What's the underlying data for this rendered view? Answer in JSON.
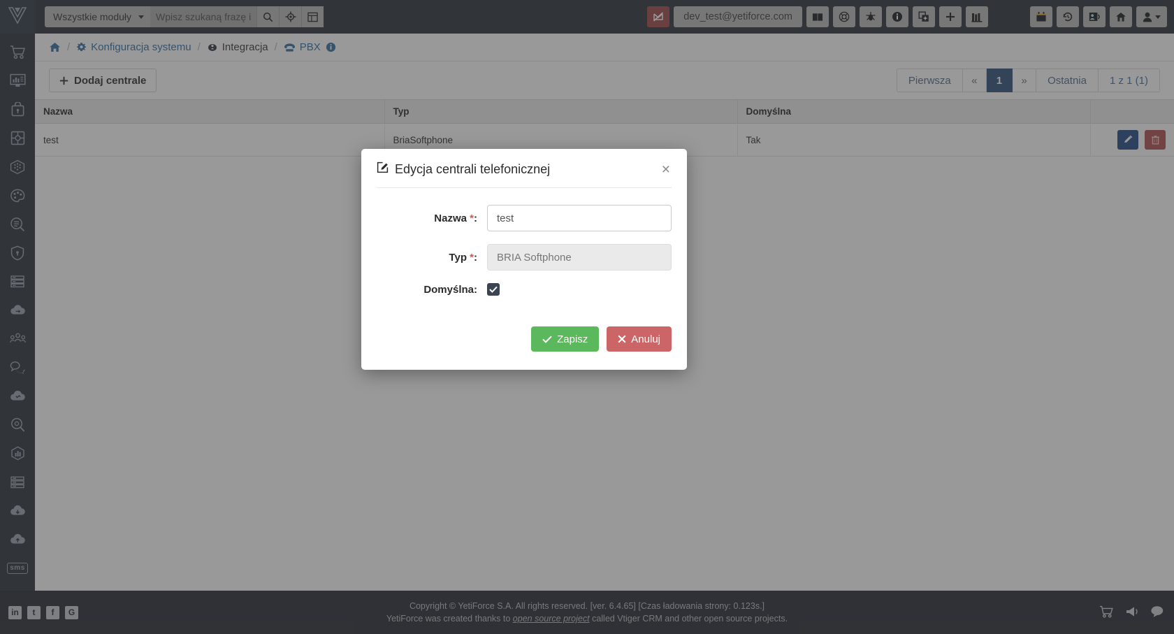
{
  "header": {
    "logo_icon": "yetiforce-logo-icon",
    "module_select": {
      "label": "Wszystkie moduły",
      "caret_icon": "caret-down-icon"
    },
    "search": {
      "placeholder": "Wpisz szukaną frazę i wciś",
      "value": ""
    },
    "search_icon": "search-icon",
    "crosshair_icon": "crosshair-icon",
    "grid_icon": "grid-icon",
    "mail_toggle_icon": "mail-slash-icon",
    "user_email": "dev_test@yetiforce.com",
    "icons_left": [
      {
        "name": "book-icon",
        "label": "book"
      },
      {
        "name": "life-ring-icon",
        "label": "life-ring"
      },
      {
        "name": "bug-icon",
        "label": "bug"
      },
      {
        "name": "info-circle-icon",
        "label": "info"
      },
      {
        "name": "clone-add-icon",
        "label": "clone"
      },
      {
        "name": "plus-icon",
        "label": "plus"
      },
      {
        "name": "library-icon",
        "label": "library"
      }
    ],
    "icons_right": [
      {
        "name": "calendar-icon",
        "label": "calendar"
      },
      {
        "name": "history-icon",
        "label": "history"
      },
      {
        "name": "contacts-icon",
        "label": "contacts"
      },
      {
        "name": "home-shield-icon",
        "label": "home"
      }
    ],
    "user_menu": {
      "icon": "user-icon",
      "caret_icon": "caret-down-icon"
    }
  },
  "sidebar": {
    "items": [
      {
        "name": "sidebar-item-cart",
        "icon": "shopping-cart-icon"
      },
      {
        "name": "sidebar-item-dashboard",
        "icon": "monitor-chart-icon"
      },
      {
        "name": "sidebar-item-security-lock",
        "icon": "lock-briefcase-icon"
      },
      {
        "name": "sidebar-item-integration",
        "icon": "puzzle-icon"
      },
      {
        "name": "sidebar-item-modules",
        "icon": "cube-grid-icon"
      },
      {
        "name": "sidebar-item-appearance",
        "icon": "palette-icon"
      },
      {
        "name": "sidebar-item-search-config",
        "icon": "list-search-icon"
      },
      {
        "name": "sidebar-item-permissions",
        "icon": "shield-lock-icon"
      },
      {
        "name": "sidebar-item-database",
        "icon": "server-icon"
      },
      {
        "name": "sidebar-item-cloud-sync",
        "icon": "cloud-sync-icon"
      },
      {
        "name": "sidebar-item-users",
        "icon": "users-group-icon"
      },
      {
        "name": "sidebar-item-chat",
        "icon": "chat-bubbles-icon"
      },
      {
        "name": "sidebar-item-pbx",
        "icon": "phone-cloud-icon"
      },
      {
        "name": "sidebar-item-logs",
        "icon": "magnifier-icon"
      },
      {
        "name": "sidebar-item-stats",
        "icon": "bar-stats-icon"
      },
      {
        "name": "sidebar-item-files",
        "icon": "archive-icon"
      },
      {
        "name": "sidebar-item-cloud-download",
        "icon": "cloud-down-icon"
      },
      {
        "name": "sidebar-item-cloud-upload",
        "icon": "cloud-up-icon"
      },
      {
        "name": "sidebar-item-sms",
        "icon": "sms-icon",
        "text": "sms"
      }
    ]
  },
  "breadcrumb": {
    "home_icon": "home-icon",
    "items": [
      {
        "icon": "gear-icon",
        "label": "Konfiguracja systemu",
        "link": true
      },
      {
        "icon": "integration-icon",
        "label": "Integracja",
        "link": false
      },
      {
        "icon": "phone-icon",
        "label": "PBX",
        "link": true
      }
    ],
    "info_icon": "info-circle-icon",
    "separator": "/"
  },
  "toolbar": {
    "add_button": {
      "label": "Dodaj centrale",
      "icon": "plus-icon"
    },
    "pagination": {
      "first": "Pierwsza",
      "prev": "«",
      "current": "1",
      "next": "»",
      "last": "Ostatnia",
      "counter": "1 z 1 (1)"
    }
  },
  "table": {
    "columns": [
      "Nazwa",
      "Typ",
      "Domyślna",
      ""
    ],
    "rows": [
      {
        "nazwa": "test",
        "typ": "BriaSoftphone",
        "domyslna": "Tak",
        "edit_icon": "pencil-icon",
        "delete_icon": "trash-icon"
      }
    ]
  },
  "modal": {
    "title": "Edycja centrali telefonicznej",
    "title_icon": "pencil-square-icon",
    "close_icon": "close-icon",
    "fields": {
      "name": {
        "label": "Nazwa",
        "required_mark": "*",
        "colon": ":",
        "value": "test"
      },
      "type": {
        "label": "Typ",
        "required_mark": "*",
        "colon": ":",
        "value": "BRIA Softphone"
      },
      "default": {
        "label": "Domyślna:",
        "checked": true,
        "check_icon": "check-icon"
      }
    },
    "buttons": {
      "save": {
        "label": "Zapisz",
        "icon": "check-icon"
      },
      "cancel": {
        "label": "Anuluj",
        "icon": "times-icon"
      }
    }
  },
  "footer": {
    "line1": "Copyright © YetiForce S.A. All rights reserved. [ver. 6.4.65] [Czas ładowania strony: 0.123s.]",
    "line2_before": "YetiForce was created thanks to ",
    "line2_link": "open source project",
    "line2_after": " called Vtiger CRM and other open source projects.",
    "social": [
      {
        "name": "linkedin-icon",
        "glyph": "in"
      },
      {
        "name": "twitter-icon",
        "glyph": "t"
      },
      {
        "name": "facebook-icon",
        "glyph": "f"
      },
      {
        "name": "github-icon",
        "glyph": "G"
      }
    ],
    "right_icons": [
      {
        "name": "cart-icon"
      },
      {
        "name": "megaphone-icon"
      },
      {
        "name": "chat-icon"
      }
    ]
  },
  "colors": {
    "dark": "#272e38",
    "accent_blue": "#2a4f79",
    "save_green": "#5cb85c",
    "cancel_red": "#cc6666",
    "edit_blue": "#1e4585",
    "delete_red": "#b04a4a",
    "required_red": "#d9534f"
  }
}
